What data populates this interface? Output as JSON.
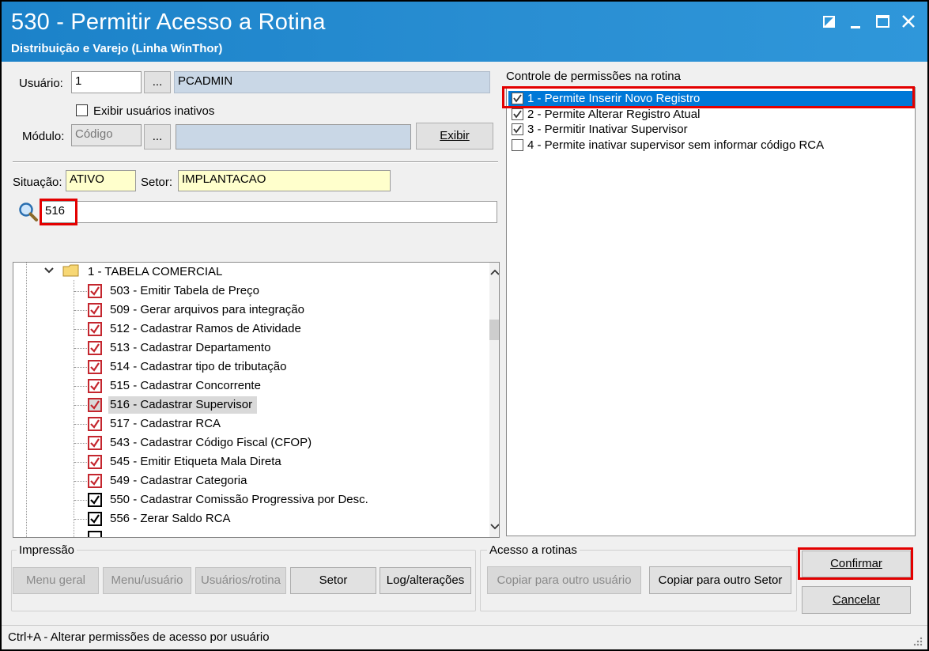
{
  "window": {
    "title": "530 - Permitir Acesso a Rotina",
    "subtitle": "Distribuição e Varejo (Linha WinThor)"
  },
  "user": {
    "label": "Usuário:",
    "code": "1",
    "browse_label": "...",
    "name": "PCADMIN",
    "show_inactive_label": "Exibir usuários inativos"
  },
  "module": {
    "label": "Módulo:",
    "placeholder": "Código",
    "browse_label": "...",
    "exibir_label": "Exibir"
  },
  "situacao": {
    "label": "Situação:",
    "value": "ATIVO"
  },
  "setor": {
    "label": "Setor:",
    "value": "IMPLANTACAO"
  },
  "search": {
    "value": "516"
  },
  "tree": {
    "root_label": "1 - TABELA COMERCIAL",
    "items": [
      {
        "label": "503 - Emitir Tabela de Preço"
      },
      {
        "label": "509 - Gerar arquivos para integração"
      },
      {
        "label": "512 - Cadastrar Ramos de Atividade"
      },
      {
        "label": "513 - Cadastrar Departamento"
      },
      {
        "label": "514 - Cadastrar tipo de tributação"
      },
      {
        "label": "515 - Cadastrar Concorrente"
      },
      {
        "label": "516 - Cadastrar Supervisor"
      },
      {
        "label": "517 - Cadastrar RCA"
      },
      {
        "label": "543 - Cadastrar Código Fiscal (CFOP)"
      },
      {
        "label": "545 - Emitir Etiqueta Mala Direta"
      },
      {
        "label": "549 - Cadastrar Categoria"
      },
      {
        "label": "550 - Cadastrar Comissão Progressiva por Desc."
      },
      {
        "label": "556 - Zerar Saldo RCA"
      }
    ]
  },
  "permissions": {
    "title": "Controle de permissões na rotina",
    "items": [
      {
        "label": "1 - Permite Inserir Novo Registro",
        "checked": true
      },
      {
        "label": "2 - Permite Alterar Registro Atual",
        "checked": true
      },
      {
        "label": "3 - Permitir Inativar Supervisor",
        "checked": true
      },
      {
        "label": "4 - Permite inativar supervisor sem informar código RCA",
        "checked": false
      }
    ]
  },
  "impressao": {
    "title": "Impressão",
    "buttons": [
      "Menu geral",
      "Menu/usuário",
      "Usuários/rotina",
      "Setor",
      "Log/alterações"
    ]
  },
  "acesso": {
    "title": "Acesso a rotinas",
    "copy_user_label": "Copiar para outro usuário",
    "copy_setor_label": "Copiar para outro Setor"
  },
  "actions": {
    "confirm_label": "Confirmar",
    "cancel_label": "Cancelar"
  },
  "status": {
    "text": "Ctrl+A - Alterar permissões de acesso por usuário"
  }
}
